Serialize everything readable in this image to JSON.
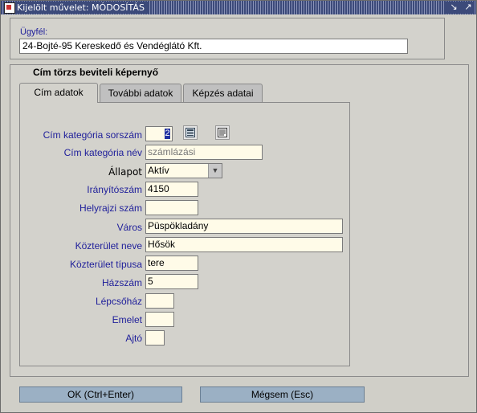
{
  "window": {
    "title": "Kijelölt művelet: MÓDOSÍTÁS",
    "controls": [
      "minimize",
      "maximize"
    ]
  },
  "customer": {
    "label": "Ügyfél:",
    "value": "24-Bojté-95 Kereskedő és Vendéglátó Kft."
  },
  "section": {
    "title": "Cím törzs beviteli képernyő"
  },
  "tabs": [
    {
      "label": "Cím adatok",
      "active": true
    },
    {
      "label": "További adatok",
      "active": false
    },
    {
      "label": "Képzés adatai",
      "active": false
    }
  ],
  "form": {
    "category_number": {
      "label": "Cím kategória sorszám",
      "value": "2"
    },
    "category_name": {
      "label": "Cím kategória név",
      "value": "számlázási"
    },
    "status": {
      "label": "Állapot",
      "value": "Aktív"
    },
    "zip": {
      "label": "Irányítószám",
      "value": "4150"
    },
    "lot_number": {
      "label": "Helyrajzi szám",
      "value": ""
    },
    "city": {
      "label": "Város",
      "value": "Püspökladány"
    },
    "street_name": {
      "label": "Közterület neve",
      "value": "Hősök"
    },
    "street_type": {
      "label": "Közterület típusa",
      "value": "tere"
    },
    "house_number": {
      "label": "Házszám",
      "value": "5"
    },
    "staircase": {
      "label": "Lépcsőház",
      "value": ""
    },
    "floor": {
      "label": "Emelet",
      "value": ""
    },
    "door": {
      "label": "Ajtó",
      "value": ""
    }
  },
  "buttons": {
    "ok": "OK (Ctrl+Enter)",
    "cancel": "Mégsem (Esc)"
  },
  "icons": {
    "lookup": "list-lookup-icon",
    "notes": "notepad-icon"
  },
  "colors": {
    "label_blue": "#1e1e9a",
    "field_bg": "#fffbe8",
    "button_bg": "#9bb0c4",
    "titlebar": "#3c4a7a"
  }
}
